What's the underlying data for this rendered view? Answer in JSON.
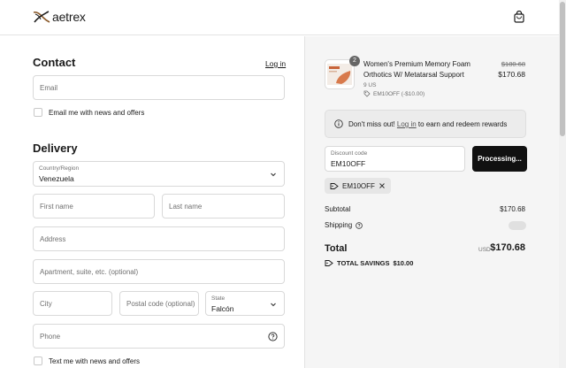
{
  "header": {
    "brand": "aetrex"
  },
  "contact": {
    "heading": "Contact",
    "login_link": "Log in",
    "email_placeholder": "Email",
    "email_optin": "Email me with news and offers"
  },
  "delivery": {
    "heading": "Delivery",
    "country_label": "Country/Region",
    "country_value": "Venezuela",
    "first_name_placeholder": "First name",
    "last_name_placeholder": "Last name",
    "address_placeholder": "Address",
    "apartment_placeholder": "Apartment, suite, etc. (optional)",
    "city_placeholder": "City",
    "postal_placeholder": "Postal code (optional)",
    "state_label": "State",
    "state_value": "Falcón",
    "phone_placeholder": "Phone",
    "text_optin": "Text me with news and offers"
  },
  "summary": {
    "item": {
      "quantity": "2",
      "name": "Women's Premium Memory Foam Orthotics W/ Metatarsal Support",
      "variant": "9 US",
      "discount": "EM10OFF (-$10.00)",
      "original_price": "$180.68",
      "price": "$170.68"
    },
    "banner": {
      "text_before": "Don't miss out!",
      "link": "Log in",
      "text_after": "to earn and redeem rewards"
    },
    "discount_label": "Discount code",
    "discount_value": "EM10OFF",
    "apply_button": "Processing...",
    "applied_code": "EM10OFF",
    "subtotal_label": "Subtotal",
    "subtotal_value": "$170.68",
    "shipping_label": "Shipping",
    "total_label": "Total",
    "total_currency": "USD",
    "total_value": "$170.68",
    "savings_label": "TOTAL SAVINGS",
    "savings_value": "$10.00"
  },
  "colors": {
    "button_bg": "#111111",
    "summary_bg": "#f5f5f5"
  }
}
